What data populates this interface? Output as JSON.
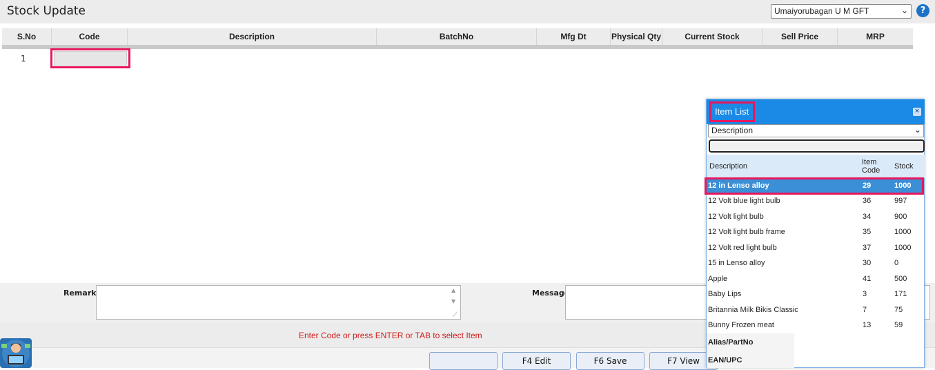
{
  "header": {
    "title": "Stock Update",
    "branch_selected": "Umaiyorubagan U M GFT",
    "help_label": "?"
  },
  "grid": {
    "columns": [
      "S.No",
      "Code",
      "Description",
      "BatchNo",
      "Mfg Dt",
      "Physical Qty",
      "Current Stock",
      "Sell Price",
      "MRP"
    ],
    "rows": [
      {
        "sno": "1",
        "code": ""
      }
    ]
  },
  "form": {
    "remarks_label": "Remarks",
    "remarks_value": "",
    "message_label": "Message",
    "message_value": ""
  },
  "status": {
    "text": "Enter Code or press ENTER or TAB to select Item",
    "color": "#d11b1b"
  },
  "footer": {
    "buttons": [
      "",
      "F4 Edit",
      "F6 Save",
      "F7 View"
    ]
  },
  "popup": {
    "title": "Item List",
    "close_label": "×",
    "search_by": "Description",
    "search_value": "",
    "headers": {
      "description": "Description",
      "item_code_line1": "Item",
      "item_code_line2": "Code",
      "stock": "Stock"
    },
    "items": [
      {
        "description": "12 in Lenso alloy",
        "code": "29",
        "stock": "1000",
        "selected": true
      },
      {
        "description": "12 Volt blue light bulb",
        "code": "36",
        "stock": "997"
      },
      {
        "description": "12 Volt light bulb",
        "code": "34",
        "stock": "900"
      },
      {
        "description": "12 Volt light bulb frame",
        "code": "35",
        "stock": "1000"
      },
      {
        "description": "12 Volt red light bulb",
        "code": "37",
        "stock": "1000"
      },
      {
        "description": "15 in Lenso alloy",
        "code": "30",
        "stock": "0"
      },
      {
        "description": "Apple",
        "code": "41",
        "stock": "500"
      },
      {
        "description": "Baby Lips",
        "code": "3",
        "stock": "171"
      },
      {
        "description": "Britannia Milk Bikis Classic",
        "code": "7",
        "stock": "75"
      },
      {
        "description": "Bunny Frozen meat",
        "code": "13",
        "stock": "59"
      }
    ],
    "search_options": [
      "Alias/PartNo",
      "EAN/UPC"
    ]
  },
  "colors": {
    "accent": "#1a8ae6",
    "highlight": "#e8175d",
    "selected_row": "#3a8fd6"
  }
}
